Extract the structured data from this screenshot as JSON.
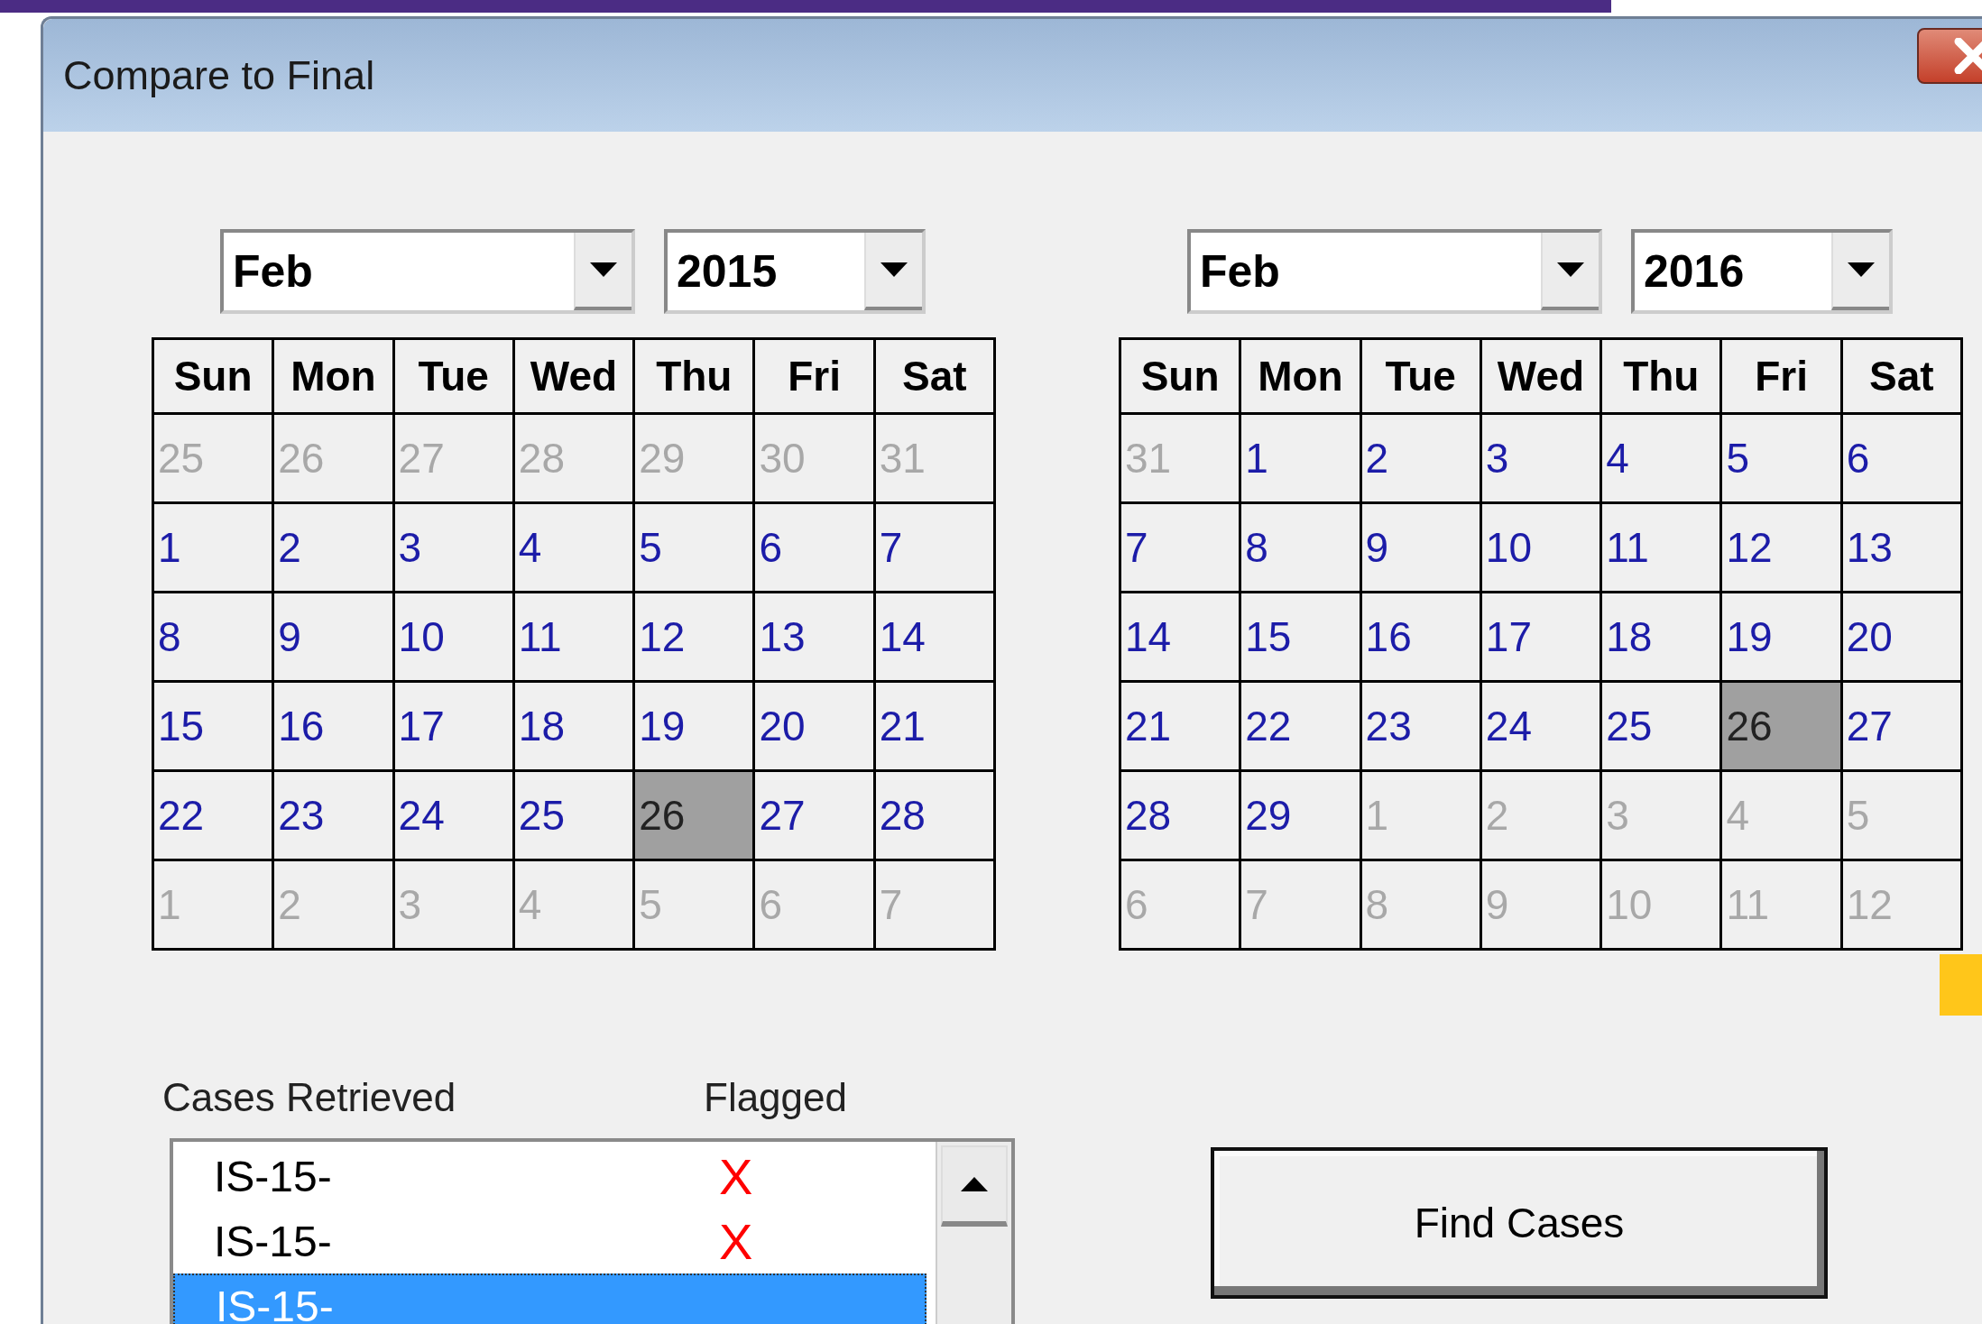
{
  "window": {
    "title": "Compare to Final"
  },
  "calendars": [
    {
      "month": "Feb",
      "year": "2015",
      "weekdays": [
        "Sun",
        "Mon",
        "Tue",
        "Wed",
        "Thu",
        "Fri",
        "Sat"
      ],
      "weeks": [
        [
          {
            "day": "25",
            "in_month": false,
            "selected": false
          },
          {
            "day": "26",
            "in_month": false,
            "selected": false
          },
          {
            "day": "27",
            "in_month": false,
            "selected": false
          },
          {
            "day": "28",
            "in_month": false,
            "selected": false
          },
          {
            "day": "29",
            "in_month": false,
            "selected": false
          },
          {
            "day": "30",
            "in_month": false,
            "selected": false
          },
          {
            "day": "31",
            "in_month": false,
            "selected": false
          }
        ],
        [
          {
            "day": "1",
            "in_month": true,
            "selected": false
          },
          {
            "day": "2",
            "in_month": true,
            "selected": false
          },
          {
            "day": "3",
            "in_month": true,
            "selected": false
          },
          {
            "day": "4",
            "in_month": true,
            "selected": false
          },
          {
            "day": "5",
            "in_month": true,
            "selected": false
          },
          {
            "day": "6",
            "in_month": true,
            "selected": false
          },
          {
            "day": "7",
            "in_month": true,
            "selected": false
          }
        ],
        [
          {
            "day": "8",
            "in_month": true,
            "selected": false
          },
          {
            "day": "9",
            "in_month": true,
            "selected": false
          },
          {
            "day": "10",
            "in_month": true,
            "selected": false
          },
          {
            "day": "11",
            "in_month": true,
            "selected": false
          },
          {
            "day": "12",
            "in_month": true,
            "selected": false
          },
          {
            "day": "13",
            "in_month": true,
            "selected": false
          },
          {
            "day": "14",
            "in_month": true,
            "selected": false
          }
        ],
        [
          {
            "day": "15",
            "in_month": true,
            "selected": false
          },
          {
            "day": "16",
            "in_month": true,
            "selected": false
          },
          {
            "day": "17",
            "in_month": true,
            "selected": false
          },
          {
            "day": "18",
            "in_month": true,
            "selected": false
          },
          {
            "day": "19",
            "in_month": true,
            "selected": false
          },
          {
            "day": "20",
            "in_month": true,
            "selected": false
          },
          {
            "day": "21",
            "in_month": true,
            "selected": false
          }
        ],
        [
          {
            "day": "22",
            "in_month": true,
            "selected": false
          },
          {
            "day": "23",
            "in_month": true,
            "selected": false
          },
          {
            "day": "24",
            "in_month": true,
            "selected": false
          },
          {
            "day": "25",
            "in_month": true,
            "selected": false
          },
          {
            "day": "26",
            "in_month": true,
            "selected": true
          },
          {
            "day": "27",
            "in_month": true,
            "selected": false
          },
          {
            "day": "28",
            "in_month": true,
            "selected": false
          }
        ],
        [
          {
            "day": "1",
            "in_month": false,
            "selected": false
          },
          {
            "day": "2",
            "in_month": false,
            "selected": false
          },
          {
            "day": "3",
            "in_month": false,
            "selected": false
          },
          {
            "day": "4",
            "in_month": false,
            "selected": false
          },
          {
            "day": "5",
            "in_month": false,
            "selected": false
          },
          {
            "day": "6",
            "in_month": false,
            "selected": false
          },
          {
            "day": "7",
            "in_month": false,
            "selected": false
          }
        ]
      ]
    },
    {
      "month": "Feb",
      "year": "2016",
      "weekdays": [
        "Sun",
        "Mon",
        "Tue",
        "Wed",
        "Thu",
        "Fri",
        "Sat"
      ],
      "weeks": [
        [
          {
            "day": "31",
            "in_month": false,
            "selected": false
          },
          {
            "day": "1",
            "in_month": true,
            "selected": false
          },
          {
            "day": "2",
            "in_month": true,
            "selected": false
          },
          {
            "day": "3",
            "in_month": true,
            "selected": false
          },
          {
            "day": "4",
            "in_month": true,
            "selected": false
          },
          {
            "day": "5",
            "in_month": true,
            "selected": false
          },
          {
            "day": "6",
            "in_month": true,
            "selected": false
          }
        ],
        [
          {
            "day": "7",
            "in_month": true,
            "selected": false
          },
          {
            "day": "8",
            "in_month": true,
            "selected": false
          },
          {
            "day": "9",
            "in_month": true,
            "selected": false
          },
          {
            "day": "10",
            "in_month": true,
            "selected": false
          },
          {
            "day": "11",
            "in_month": true,
            "selected": false
          },
          {
            "day": "12",
            "in_month": true,
            "selected": false
          },
          {
            "day": "13",
            "in_month": true,
            "selected": false
          }
        ],
        [
          {
            "day": "14",
            "in_month": true,
            "selected": false
          },
          {
            "day": "15",
            "in_month": true,
            "selected": false
          },
          {
            "day": "16",
            "in_month": true,
            "selected": false
          },
          {
            "day": "17",
            "in_month": true,
            "selected": false
          },
          {
            "day": "18",
            "in_month": true,
            "selected": false
          },
          {
            "day": "19",
            "in_month": true,
            "selected": false
          },
          {
            "day": "20",
            "in_month": true,
            "selected": false
          }
        ],
        [
          {
            "day": "21",
            "in_month": true,
            "selected": false
          },
          {
            "day": "22",
            "in_month": true,
            "selected": false
          },
          {
            "day": "23",
            "in_month": true,
            "selected": false
          },
          {
            "day": "24",
            "in_month": true,
            "selected": false
          },
          {
            "day": "25",
            "in_month": true,
            "selected": false
          },
          {
            "day": "26",
            "in_month": true,
            "selected": true
          },
          {
            "day": "27",
            "in_month": true,
            "selected": false
          }
        ],
        [
          {
            "day": "28",
            "in_month": true,
            "selected": false
          },
          {
            "day": "29",
            "in_month": true,
            "selected": false
          },
          {
            "day": "1",
            "in_month": false,
            "selected": false
          },
          {
            "day": "2",
            "in_month": false,
            "selected": false
          },
          {
            "day": "3",
            "in_month": false,
            "selected": false
          },
          {
            "day": "4",
            "in_month": false,
            "selected": false
          },
          {
            "day": "5",
            "in_month": false,
            "selected": false
          }
        ],
        [
          {
            "day": "6",
            "in_month": false,
            "selected": false
          },
          {
            "day": "7",
            "in_month": false,
            "selected": false
          },
          {
            "day": "8",
            "in_month": false,
            "selected": false
          },
          {
            "day": "9",
            "in_month": false,
            "selected": false
          },
          {
            "day": "10",
            "in_month": false,
            "selected": false
          },
          {
            "day": "11",
            "in_month": false,
            "selected": false
          },
          {
            "day": "12",
            "in_month": false,
            "selected": false
          }
        ]
      ]
    }
  ],
  "cases": {
    "columns": [
      "Cases Retrieved",
      "Flagged"
    ],
    "items": [
      {
        "case": "IS-15-",
        "flag": "X",
        "selected": false
      },
      {
        "case": "IS-15-",
        "flag": "X",
        "selected": false
      },
      {
        "case": "IS-15-",
        "selected": true
      }
    ]
  },
  "buttons": [
    "Find Cases"
  ]
}
